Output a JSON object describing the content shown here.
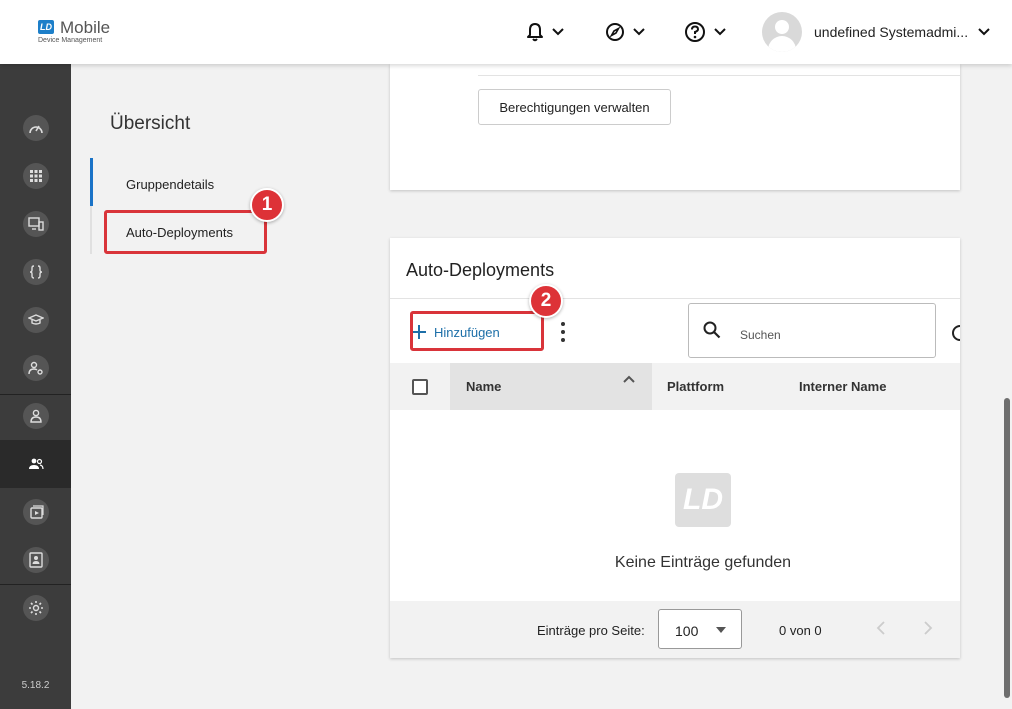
{
  "header": {
    "logo_badge": "LD",
    "logo_title": "Mobile",
    "logo_subtitle": "Device Management",
    "icons": [
      "bell-icon",
      "compass-icon",
      "help-icon"
    ],
    "user_name": "undefined Systemadmi..."
  },
  "sidebar": {
    "items": [
      "dashboard-icon",
      "apps-icon",
      "devices-icon",
      "code-icon",
      "education-icon",
      "user-settings-icon",
      "user-icon",
      "groups-icon",
      "deployments-icon",
      "profile-icon",
      "settings-icon"
    ],
    "active": "groups-icon",
    "version": "5.18.2"
  },
  "nav": {
    "title": "Übersicht",
    "items": [
      {
        "label": "Gruppendetails",
        "active": true
      },
      {
        "label": "Auto-Deployments",
        "active": false
      }
    ]
  },
  "annotations": {
    "badge1": "1",
    "badge2": "2",
    "highlight_color": "#d9343a"
  },
  "permissions_card": {
    "button_label": "Berechtigungen verwalten"
  },
  "auto_deployments": {
    "title": "Auto-Deployments",
    "add_label": "Hinzufügen",
    "search_placeholder": "Suchen",
    "columns": [
      "Name",
      "Plattform",
      "Interner Name"
    ],
    "empty_logo": "LD",
    "empty_text": "Keine Einträge gefunden",
    "per_page_label": "Einträge pro Seite:",
    "per_page_value": "100",
    "range": "0 von 0"
  },
  "colors": {
    "accent": "#1d7fc9",
    "link": "#1d6fa8",
    "sidebar": "#3c3c3c"
  }
}
